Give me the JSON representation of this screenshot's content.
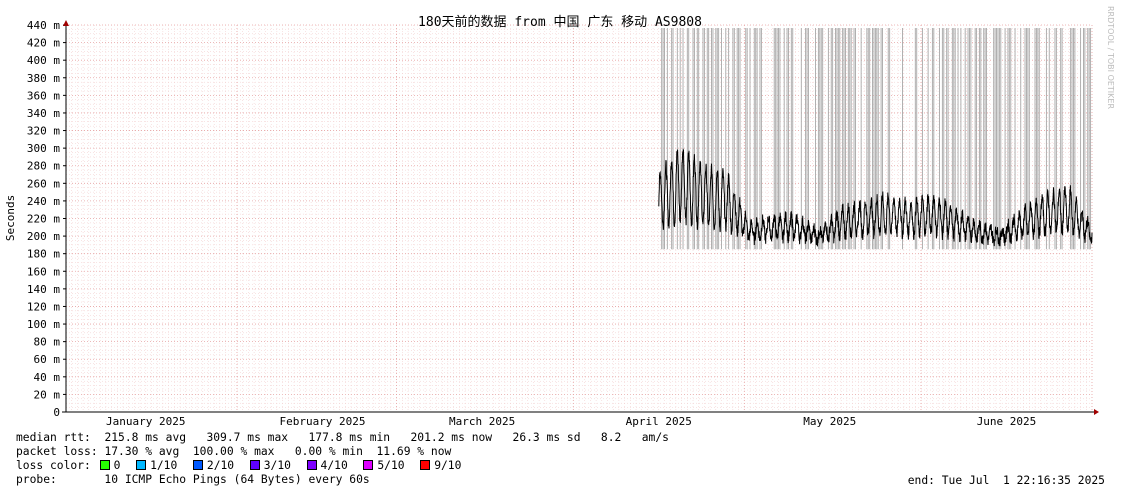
{
  "chart_data": {
    "type": "line",
    "title": "180天前的数据 from 中国 广东 移动 AS9808",
    "ylabel": "Seconds",
    "side_label": "RRDTOOL / TOBI OETIKER",
    "ylim": [
      0,
      440
    ],
    "yticks": [
      "0",
      "20 m",
      "40 m",
      "60 m",
      "80 m",
      "100 m",
      "120 m",
      "140 m",
      "160 m",
      "180 m",
      "200 m",
      "220 m",
      "240 m",
      "260 m",
      "280 m",
      "300 m",
      "320 m",
      "340 m",
      "360 m",
      "380 m",
      "400 m",
      "420 m",
      "440 m"
    ],
    "x_labels": [
      "January 2025",
      "February 2025",
      "March 2025",
      "April 2025",
      "May 2025",
      "June 2025"
    ],
    "x_range": [
      "2025-01-02",
      "2025-07-01"
    ],
    "grid": true,
    "series": [
      {
        "name": "median rtt",
        "color": "#000000",
        "approx_points": [
          [
            "2025-04-16",
            240
          ],
          [
            "2025-04-20",
            260
          ],
          [
            "2025-04-24",
            245
          ],
          [
            "2025-04-28",
            240
          ],
          [
            "2025-05-02",
            205
          ],
          [
            "2025-05-06",
            210
          ],
          [
            "2025-05-10",
            210
          ],
          [
            "2025-05-14",
            200
          ],
          [
            "2025-05-18",
            215
          ],
          [
            "2025-05-22",
            220
          ],
          [
            "2025-05-26",
            225
          ],
          [
            "2025-05-30",
            220
          ],
          [
            "2025-06-03",
            225
          ],
          [
            "2025-06-07",
            215
          ],
          [
            "2025-06-11",
            205
          ],
          [
            "2025-06-15",
            200
          ],
          [
            "2025-06-19",
            215
          ],
          [
            "2025-06-23",
            225
          ],
          [
            "2025-06-27",
            230
          ],
          [
            "2025-07-01",
            201
          ]
        ]
      }
    ],
    "loss_periods_note": "grey bars mark sampling periods with packet loss (reaching top of chart)"
  },
  "stats": {
    "median_label": "median rtt:",
    "median_values": "215.8 ms avg   309.7 ms max   177.8 ms min   201.2 ms now   26.3 ms sd   8.2   am/s",
    "loss_label": "packet loss:",
    "loss_values": "17.30 % avg  100.00 % max   0.00 % min  11.69 % now",
    "color_label": "loss color:",
    "loss_colors": [
      {
        "label": "0",
        "color": "#26ff00"
      },
      {
        "label": "1/10",
        "color": "#00b8ff"
      },
      {
        "label": "2/10",
        "color": "#0059ff"
      },
      {
        "label": "3/10",
        "color": "#5e00ff"
      },
      {
        "label": "4/10",
        "color": "#7e00ff"
      },
      {
        "label": "5/10",
        "color": "#dd00ff"
      },
      {
        "label": "9/10",
        "color": "#ff0000"
      }
    ],
    "probe_label": "probe:",
    "probe_value": "10 ICMP Echo Pings (64 Bytes) every 60s",
    "end_text": "end: Tue Jul  1 22:16:35 2025"
  }
}
